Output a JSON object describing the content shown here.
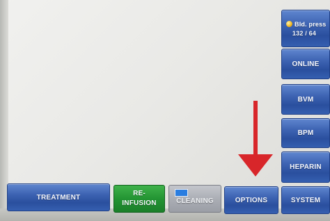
{
  "side_panel": {
    "bld_press_label": "Bld. press",
    "bld_press_value": "132 / 64",
    "online_label": "ONLINE",
    "bvm_label": "BVM",
    "bpm_label": "BPM",
    "heparin_label": "HEPARIN"
  },
  "bottom_bar": {
    "treatment_label": "TREATMENT",
    "reinfusion_line1": "RE-",
    "reinfusion_line2": "INFUSION",
    "cleaning_label": "CLEANING",
    "options_label": "OPTIONS",
    "system_label": "SYSTEM"
  },
  "annotation": {
    "arrow_color": "#d8262a",
    "arrow_direction": "down",
    "arrow_target": "options-button"
  },
  "colors": {
    "button_blue": "#3e64b3",
    "button_green": "#239433",
    "button_grey": "#a9acb3",
    "status_dot": "#f1b51c"
  }
}
